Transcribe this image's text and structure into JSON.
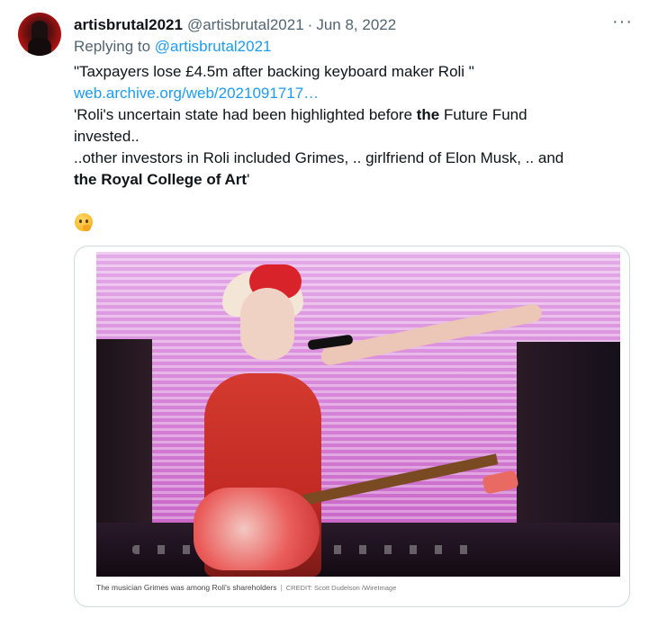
{
  "tweet": {
    "display_name": "artisbrutal2021",
    "handle": "@artisbrutal2021",
    "separator": "·",
    "date": "Jun 8, 2022",
    "more_icon": "more-horizontal-icon",
    "more_glyph": "···",
    "replying_prefix": "Replying to ",
    "replying_to": "@artisbrutal2021",
    "lines": {
      "l1": "\"Taxpayers lose £4.5m after backing keyboard maker Roli \"",
      "link": "web.archive.org/web/2021091717…",
      "l3_a": "'Roli's uncertain state had been highlighted before ",
      "l3_b": "the",
      "l3_c": " Future Fund",
      "l4": "invested..",
      "l5": "..other investors in Roli included Grimes, .. girlfriend of Elon Musk, .. and",
      "l6_a": "the Royal College of Art",
      "l6_b": "'"
    },
    "emoji": "thinking-face-emoji"
  },
  "media": {
    "image_subject": "musician-on-stage-photo",
    "caption": "The musician Grimes was among Roli's shareholders",
    "caption_sep": "|",
    "credit": "CREDIT: Scott Dudelson /WireImage"
  },
  "colors": {
    "link": "#1d9bf0",
    "secondary_text": "#536471",
    "primary_text": "#0f1419",
    "border": "#cfd9de"
  }
}
